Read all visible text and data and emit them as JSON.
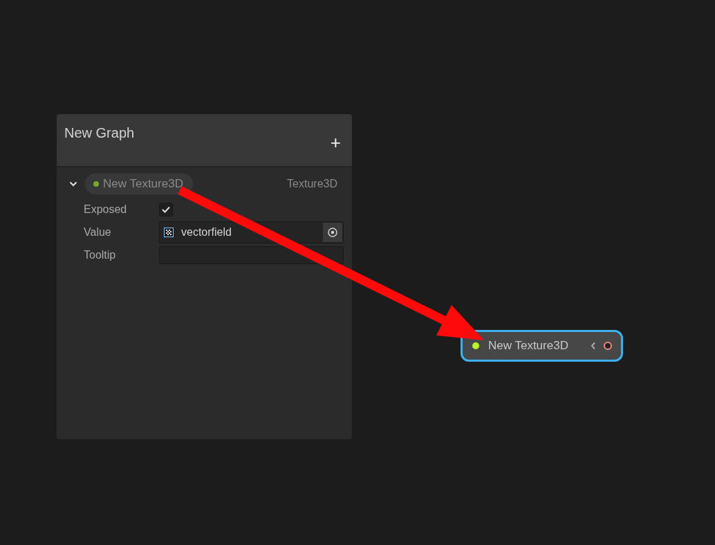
{
  "blackboard": {
    "title": "New Graph",
    "add_button": "+",
    "property": {
      "name": "New Texture3D",
      "type": "Texture3D",
      "expanded": true,
      "fields": [
        {
          "kind": "checkbox",
          "label": "Exposed",
          "checked": true
        },
        {
          "kind": "object",
          "label": "Value",
          "value": "vectorfield"
        },
        {
          "kind": "text",
          "label": "Tooltip"
        }
      ]
    }
  },
  "node": {
    "label": "New Texture3D",
    "selected": true
  }
}
